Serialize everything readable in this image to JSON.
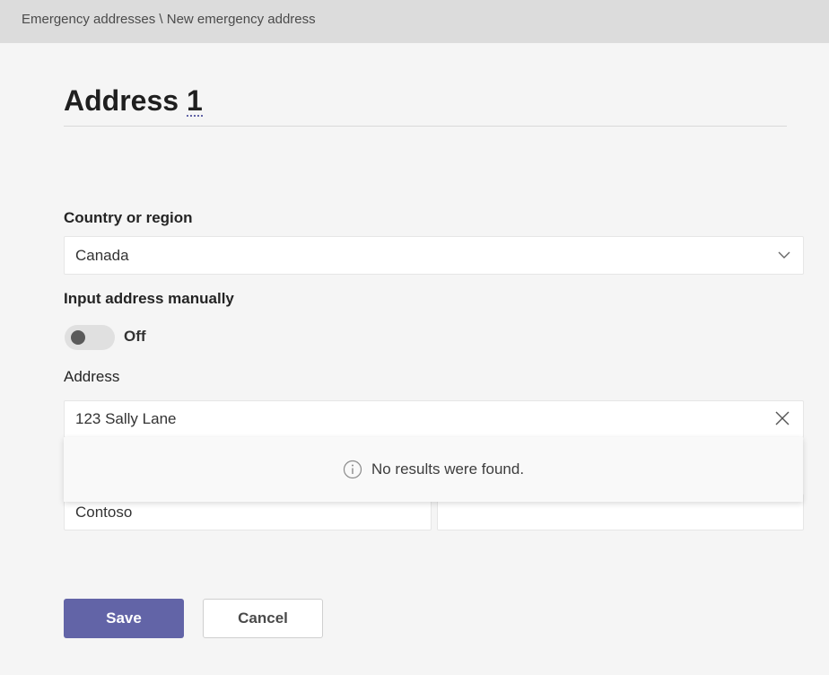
{
  "breadcrumb": {
    "text": "Emergency addresses \\ New emergency address"
  },
  "title": {
    "main": "Address",
    "number": "1"
  },
  "country": {
    "label": "Country or region",
    "value": "Canada"
  },
  "manual_input": {
    "label": "Input address manually",
    "toggle_state": "Off"
  },
  "address": {
    "label": "Address",
    "value": "123 Sally Lane"
  },
  "search_results": {
    "message": "No results were found."
  },
  "organization": {
    "value": "Contoso",
    "second_value": ""
  },
  "actions": {
    "save_label": "Save",
    "cancel_label": "Cancel"
  },
  "colors": {
    "accent": "#6264a7",
    "topbar": "#dcdcdc",
    "background": "#f5f5f5"
  },
  "icons": {
    "country_dropdown": "chevron-down-icon",
    "address_clear": "close-icon",
    "results_info": "info-icon"
  }
}
